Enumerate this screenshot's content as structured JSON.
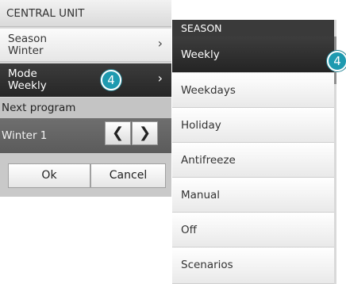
{
  "central_unit": {
    "title": "CENTRAL UNIT",
    "season": {
      "label": "Season",
      "value": "Winter",
      "chevron": "›"
    },
    "mode": {
      "label": "Mode",
      "value": "Weekly",
      "chevron": "›"
    },
    "next_program": {
      "label": "Next program",
      "value": "Winter 1"
    },
    "prev_arrow": "❮",
    "next_arrow": "❯",
    "ok_label": "Ok",
    "cancel_label": "Cancel",
    "badge": "4"
  },
  "season_menu": {
    "title": "SEASON",
    "items": [
      {
        "label": "Weekly",
        "selected": true
      },
      {
        "label": "Weekdays",
        "selected": false
      },
      {
        "label": "Holiday",
        "selected": false
      },
      {
        "label": "Antifreeze",
        "selected": false
      },
      {
        "label": "Manual",
        "selected": false
      },
      {
        "label": "Off",
        "selected": false
      },
      {
        "label": "Scenarios",
        "selected": false
      }
    ],
    "badge": "4"
  },
  "colors": {
    "accent_badge": "#1e9ab0",
    "selected_row": "#2f2f2f",
    "header_dark": "#3a3a3a"
  }
}
